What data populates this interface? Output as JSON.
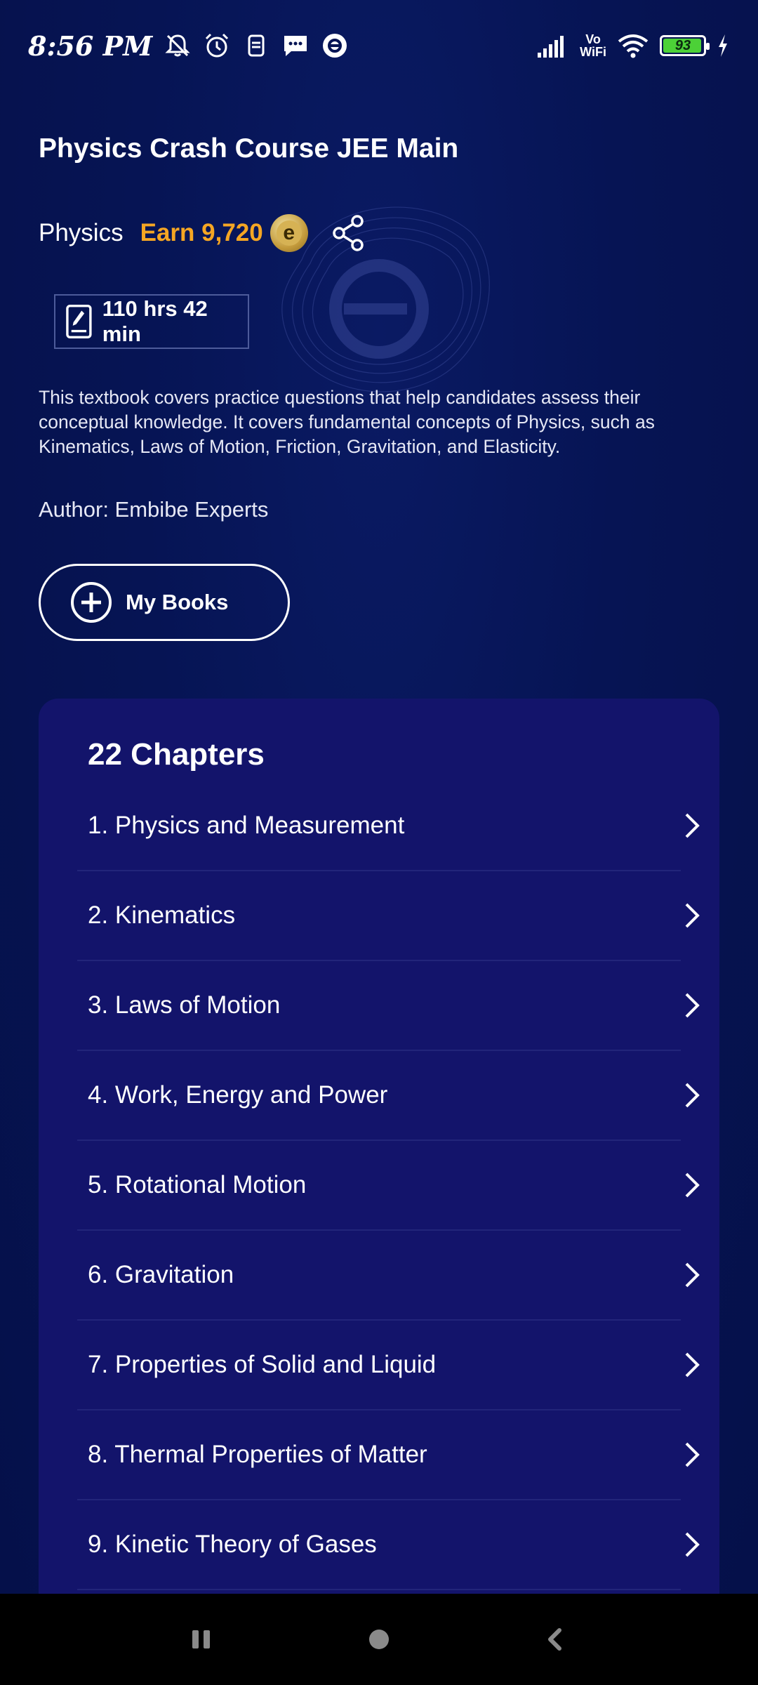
{
  "status_bar": {
    "time": "8:56 PM",
    "battery": "93",
    "vowifi_top": "Vo",
    "vowifi_bottom": "WiFi"
  },
  "course": {
    "title": "Physics Crash Course JEE Main",
    "subject": "Physics",
    "earn_label": "Earn 9,720",
    "coin_glyph": "e",
    "duration": "110 hrs 42 min",
    "description": "This textbook covers practice questions that help candidates assess their conceptual knowledge. It covers fundamental concepts of Physics, such as Kinematics, Laws of Motion, Friction, Gravitation, and Elasticity.",
    "author": "Author: Embibe Experts",
    "my_books_label": "My Books"
  },
  "chapters": {
    "heading": "22 Chapters",
    "items": [
      "1. Physics and Measurement",
      "2. Kinematics",
      "3. Laws of Motion",
      "4. Work, Energy and Power",
      "5. Rotational Motion",
      "6. Gravitation",
      "7. Properties of Solid and Liquid",
      "8. Thermal Properties of Matter",
      "9. Kinetic Theory of Gases"
    ]
  },
  "colors": {
    "background": "#061454",
    "card": "#13146b",
    "accent_earn": "#f5a623"
  },
  "icons": [
    "mute-icon",
    "alarm-icon",
    "sim-icon",
    "message-icon",
    "embibe-icon",
    "signal-icon",
    "wifi-icon",
    "battery-icon",
    "charging-icon",
    "share-icon",
    "pencil-book-icon",
    "plus-circle-icon",
    "chevron-right-icon",
    "recents-icon",
    "home-icon",
    "back-icon"
  ]
}
